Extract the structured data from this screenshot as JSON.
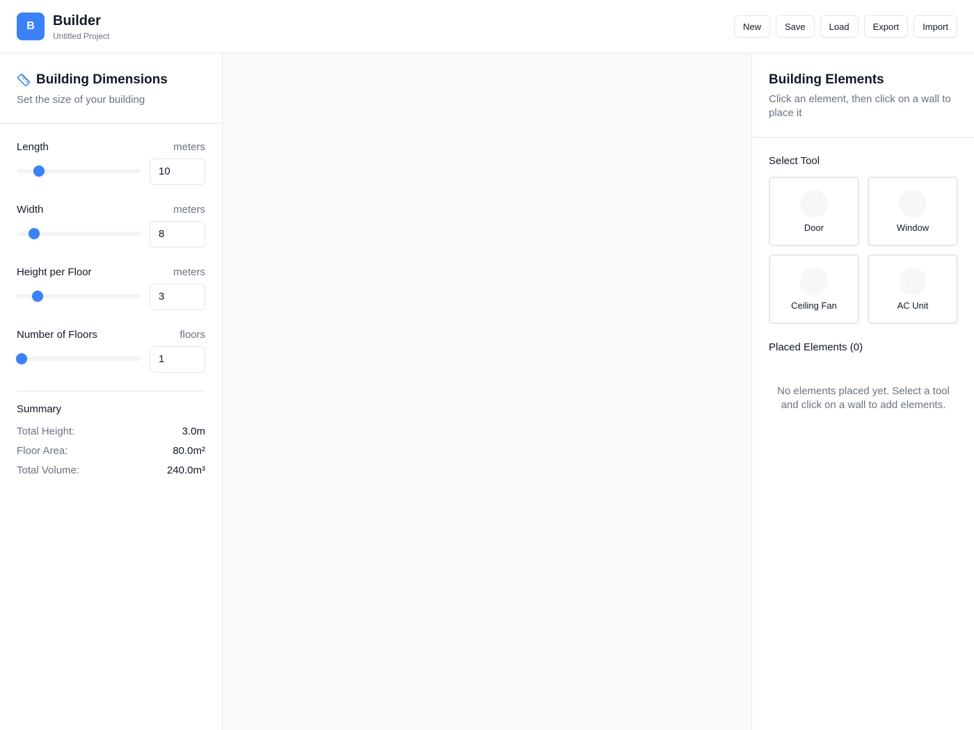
{
  "header": {
    "logo_letter": "B",
    "title": "Builder",
    "subtitle": "Untitled Project",
    "buttons": [
      {
        "label": "New"
      },
      {
        "label": "Save"
      },
      {
        "label": "Load"
      },
      {
        "label": "Export"
      },
      {
        "label": "Import"
      }
    ]
  },
  "dimensions": {
    "icon": "ruler-icon",
    "title": "Building Dimensions",
    "subtitle": "Set the size of your building",
    "fields": [
      {
        "label": "Length",
        "unit": "meters",
        "value": "10",
        "slider_fraction": 0.18
      },
      {
        "label": "Width",
        "unit": "meters",
        "value": "8",
        "slider_fraction": 0.14
      },
      {
        "label": "Height per Floor",
        "unit": "meters",
        "value": "3",
        "slider_fraction": 0.17
      },
      {
        "label": "Number of Floors",
        "unit": "floors",
        "value": "1",
        "slider_fraction": 0.04
      }
    ],
    "summary": {
      "title": "Summary",
      "rows": [
        {
          "label": "Total Height:",
          "value": "3.0m"
        },
        {
          "label": "Floor Area:",
          "value": "80.0m²"
        },
        {
          "label": "Total Volume:",
          "value": "240.0m³"
        }
      ]
    }
  },
  "elements": {
    "title": "Building Elements",
    "subtitle": "Click an element, then click on a wall to place it",
    "select_tool_label": "Select Tool",
    "tools": [
      {
        "label": "Door",
        "icon_text": "D",
        "icon": "door-icon"
      },
      {
        "label": "Window",
        "icon_text": "W",
        "icon": "window-icon"
      },
      {
        "label": "Ceiling Fan",
        "icon_text": "F",
        "icon": "fan-icon"
      },
      {
        "label": "AC Unit",
        "icon_text": "A",
        "icon": "ac-unit-icon"
      }
    ],
    "placed_title": "Placed Elements (0)",
    "empty_message": "No elements placed yet. Select a tool and click on a wall to add elements."
  },
  "colors": {
    "accent": "#3b82f6",
    "border": "#e5e7eb",
    "muted_text": "#6b7280",
    "canvas_bg": "#f9fafb"
  }
}
